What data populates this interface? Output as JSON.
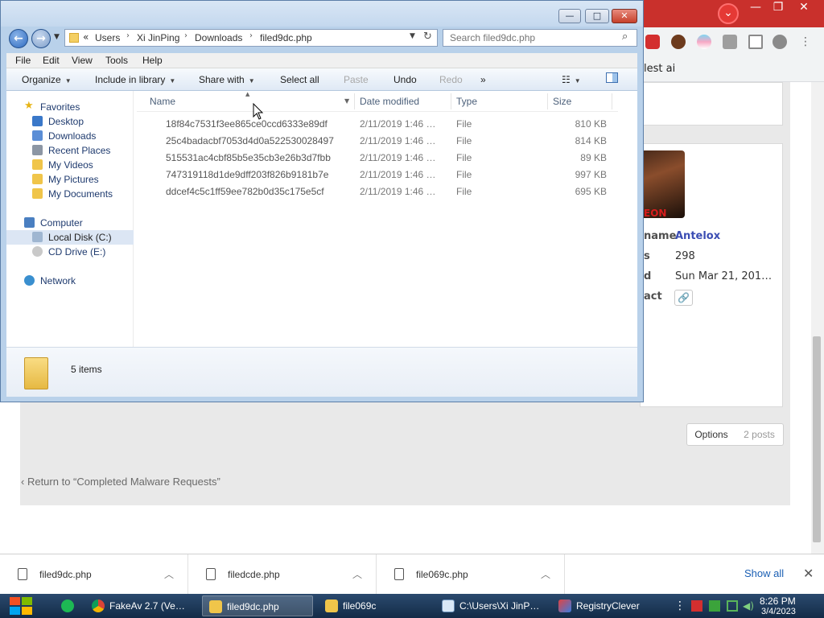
{
  "chrome": {
    "window_controls": {
      "minimize": "—",
      "restore": "❐",
      "close": "✕"
    },
    "profile_badge": "⌄",
    "bookmark_text": "lest ai",
    "accent_color": "#c9302c"
  },
  "forum": {
    "avatar_caption": "EON",
    "labels": [
      "name",
      "s",
      "d",
      "act"
    ],
    "username": "Antelox",
    "posts": "298",
    "joined": "Sun Mar 21, 201…",
    "contact_icon": "link-icon",
    "options_label": "Options",
    "posts_count": "2 posts",
    "return_link": "Return to “Completed Malware Requests”"
  },
  "explorer": {
    "window_controls": {
      "minimize": "—",
      "maximize": "□",
      "close": "✕"
    },
    "address": {
      "chevron": "«",
      "crumbs": [
        "Users",
        "Xi JinPing",
        "Downloads",
        "filed9dc.php"
      ]
    },
    "search_placeholder": "Search filed9dc.php",
    "menu": [
      "File",
      "Edit",
      "View",
      "Tools",
      "Help"
    ],
    "commands": {
      "organize": "Organize",
      "include_library": "Include in library",
      "share_with": "Share with",
      "select_all": "Select all",
      "paste": "Paste",
      "undo": "Undo",
      "redo": "Redo",
      "more": "»"
    },
    "nav": {
      "favorites": "Favorites",
      "desktop": "Desktop",
      "downloads": "Downloads",
      "recent_places": "Recent Places",
      "my_videos": "My Videos",
      "my_pictures": "My Pictures",
      "my_documents": "My Documents",
      "computer": "Computer",
      "local_disk": "Local Disk (C:)",
      "cd_drive": "CD Drive (E:)",
      "network": "Network"
    },
    "columns": {
      "name": "Name",
      "date": "Date modified",
      "type": "Type",
      "size": "Size"
    },
    "files": [
      {
        "name": "18f84c7531f3ee865ce0ccd6333e89df",
        "date": "2/11/2019 1:46 …",
        "type": "File",
        "size": "810 KB"
      },
      {
        "name": "25c4badacbf7053d4d0a522530028497",
        "date": "2/11/2019 1:46 …",
        "type": "File",
        "size": "814 KB"
      },
      {
        "name": "515531ac4cbf85b5e35cb3e26b3d7fbb",
        "date": "2/11/2019 1:46 …",
        "type": "File",
        "size": "89 KB"
      },
      {
        "name": "747319118d1de9dff203f826b9181b7e",
        "date": "2/11/2019 1:46 …",
        "type": "File",
        "size": "997 KB"
      },
      {
        "name": "ddcef4c5c1ff59ee782b0d35c175e5cf",
        "date": "2/11/2019 1:46 …",
        "type": "File",
        "size": "695 KB"
      }
    ],
    "item_count": "5 items"
  },
  "downloads_shelf": {
    "items": [
      {
        "name": "filed9dc.php"
      },
      {
        "name": "filedcde.php"
      },
      {
        "name": "file069c.php"
      }
    ],
    "show_all": "Show all",
    "close": "✕"
  },
  "taskbar": {
    "tasks": [
      {
        "label": "FakeAv 2.7 (Ve…",
        "icon": "chrome-icon"
      },
      {
        "label": "filed9dc.php",
        "icon": "folder-icon"
      },
      {
        "label": "file069c",
        "icon": "folder-icon"
      },
      {
        "label": "C:\\Users\\Xi JinP…",
        "icon": "notepad-icon"
      },
      {
        "label": "RegistryClever",
        "icon": "registry-icon"
      }
    ],
    "time": "8:26 PM",
    "date": "3/4/2023"
  }
}
